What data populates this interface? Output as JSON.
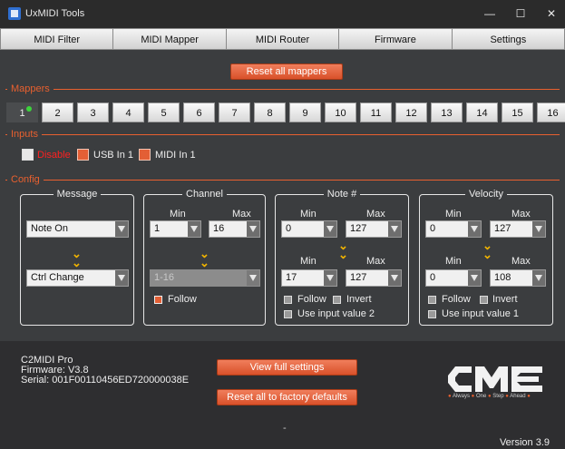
{
  "window": {
    "title": "UxMIDI Tools",
    "minimize": "—",
    "maximize": "☐",
    "close": "✕"
  },
  "tabs": [
    "MIDI Filter",
    "MIDI Mapper",
    "MIDI Router",
    "Firmware",
    "Settings"
  ],
  "reset_mappers_label": "Reset all mappers",
  "sections": {
    "mappers": "Mappers",
    "inputs": "Inputs",
    "config": "Config"
  },
  "mapper_numbers": [
    "1",
    "2",
    "3",
    "4",
    "5",
    "6",
    "7",
    "8",
    "9",
    "10",
    "11",
    "12",
    "13",
    "14",
    "15",
    "16"
  ],
  "inputs": {
    "disable_label": "Disable",
    "usb_label": "USB In 1",
    "midi_label": "MIDI In 1"
  },
  "config": {
    "message": {
      "title": "Message",
      "source": "Note On",
      "target": "Ctrl Change"
    },
    "channel": {
      "title": "Channel",
      "min_label": "Min",
      "max_label": "Max",
      "min": "1",
      "max": "16",
      "target": "1-16",
      "follow_label": "Follow"
    },
    "note": {
      "title": "Note #",
      "min_label": "Min",
      "max_label": "Max",
      "src_min": "0",
      "src_max": "127",
      "dst_min": "17",
      "dst_max": "127",
      "follow_label": "Follow",
      "invert_label": "Invert",
      "use_input_label": "Use input value 2"
    },
    "velocity": {
      "title": "Velocity",
      "min_label": "Min",
      "max_label": "Max",
      "src_min": "0",
      "src_max": "127",
      "dst_min": "0",
      "dst_max": "108",
      "follow_label": "Follow",
      "invert_label": "Invert",
      "use_input_label": "Use input value 1"
    }
  },
  "device": {
    "name": "C2MIDI Pro",
    "firmware": "Firmware: V3.8",
    "serial": "Serial: 001F00110456ED720000038E"
  },
  "view_full_label": "View full settings",
  "reset_factory_label": "Reset all to factory defaults",
  "logo": {
    "text": "CME",
    "tagline": [
      "Always",
      "One",
      "Step",
      "Ahead"
    ]
  },
  "separator_dash": "-",
  "version": "Version 3.9",
  "colors": {
    "accent": "#e8602f",
    "background": "#3b3d3f",
    "chevron": "#f2b400"
  }
}
